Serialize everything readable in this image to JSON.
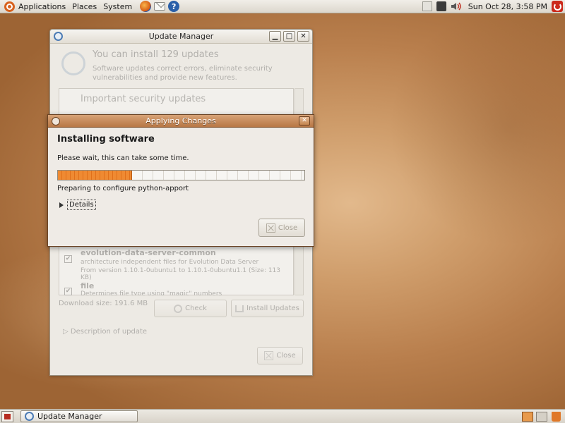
{
  "top_panel": {
    "menus": [
      "Applications",
      "Places",
      "System"
    ],
    "clock": "Sun Oct 28,  3:58 PM"
  },
  "bottom_panel": {
    "taskbar_item": "Update Manager"
  },
  "update_manager": {
    "title": "Update Manager",
    "heading": "You can install 129 updates",
    "subtext": "Software updates correct errors, eliminate security vulnerabilities and provide new features.",
    "group_title": "Important security updates",
    "packages": [
      {
        "name": "evolution-data-server-common",
        "description": "architecture independent files for Evolution Data Server",
        "version": "From version 1.10.1-0ubuntu1 to 1.10.1-0ubuntu1.1 (Size: 113 KB)",
        "checked": true
      },
      {
        "name": "file",
        "description": "Determines file type using \"magic\" numbers",
        "version": "",
        "checked": true
      }
    ],
    "download_size": "Download size: 191.6 MB",
    "check_label": "Check",
    "install_label": "Install Updates",
    "description_toggle": "Description of update",
    "close_label": "Close"
  },
  "dialog": {
    "title": "Applying Changes",
    "heading": "Installing software",
    "message": "Please wait, this can take some time.",
    "progress_fraction": 0.3,
    "status": "Preparing to configure python-apport",
    "details_label": "Details",
    "close_label": "Close"
  },
  "colors": {
    "accent_orange": "#e0701a",
    "dialog_titlebar": "#c38452"
  },
  "icons": {
    "distro_logo": "ubuntu-logo-icon",
    "browser": "firefox-icon",
    "mail": "mail-icon",
    "help": "help-icon",
    "power": "power-icon"
  }
}
